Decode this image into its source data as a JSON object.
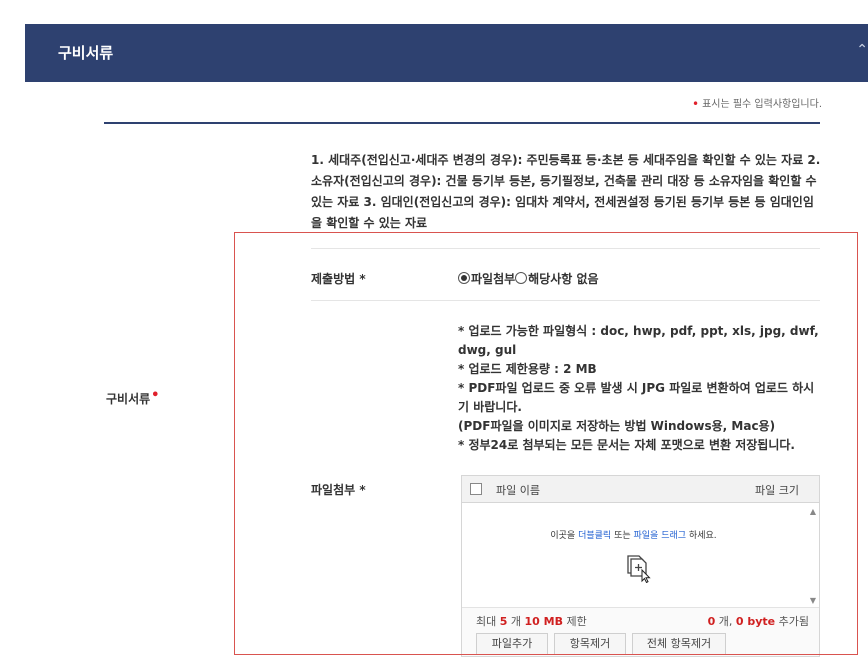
{
  "header": {
    "title": "구비서류",
    "toggle_icon": "chevron-up-icon"
  },
  "required_note": {
    "star": "•",
    "text": "표시는 필수 입력사항입니다."
  },
  "description": "1. 세대주(전입신고·세대주 변경의 경우): 주민등록표 등·초본 등 세대주임을 확인할 수 있는 자료 2. 소유자(전입신고의 경우): 건물 등기부 등본, 등기필정보, 건축물 관리 대장 등 소유자임을 확인할 수 있는 자료 3. 임대인(전입신고의 경우): 임대차 계약서, 전세권설정 등기된 등기부 등본 등 임대인임을 확인할 수 있는 자료",
  "main_label": "구비서류",
  "main_label_star": "•",
  "submit_method": {
    "label": "제출방법 *",
    "options": [
      {
        "label": "파일첨부",
        "selected": true
      },
      {
        "label": "해당사항 없음",
        "selected": false
      }
    ]
  },
  "attach": {
    "label": "파일첨부 *",
    "notes": [
      "* 업로드 가능한 파일형식 : doc, hwp, pdf, ppt, xls, jpg, dwf, dwg, gul",
      "* 업로드 제한용량 : 2 MB",
      "* PDF파일 업로드 중 오류 발생 시 JPG 파일로 변환하여 업로드 하시기 바랍니다.",
      " (PDF파일을 이미지로 저장하는 방법 Windows용, Mac용)",
      "* 정부24로 첨부되는 모든 문서는 자체 포맷으로 변환 저장됩니다."
    ]
  },
  "uploader": {
    "col_name": "파일 이름",
    "col_size": "파일 크기",
    "hint_pre": "이곳을 ",
    "hint_dbl": "더블클릭",
    "hint_mid": " 또는 ",
    "hint_drag": "파일을 드래그",
    "hint_post": " 하세요.",
    "limit_pre": "최대 ",
    "limit_count": "5",
    "limit_mid": " 개 ",
    "limit_size": "10 MB",
    "limit_post": " 제한",
    "count_num": "0",
    "count_mid": " 개, ",
    "count_bytes": "0 byte",
    "count_post": " 추가됨",
    "buttons": [
      "파일추가",
      "항목제거",
      "전체 항목제거"
    ]
  },
  "colors": {
    "header_bg": "#2e4170",
    "required": "#e0202b",
    "link": "#1f5fd1",
    "frame": "#d9534f"
  }
}
